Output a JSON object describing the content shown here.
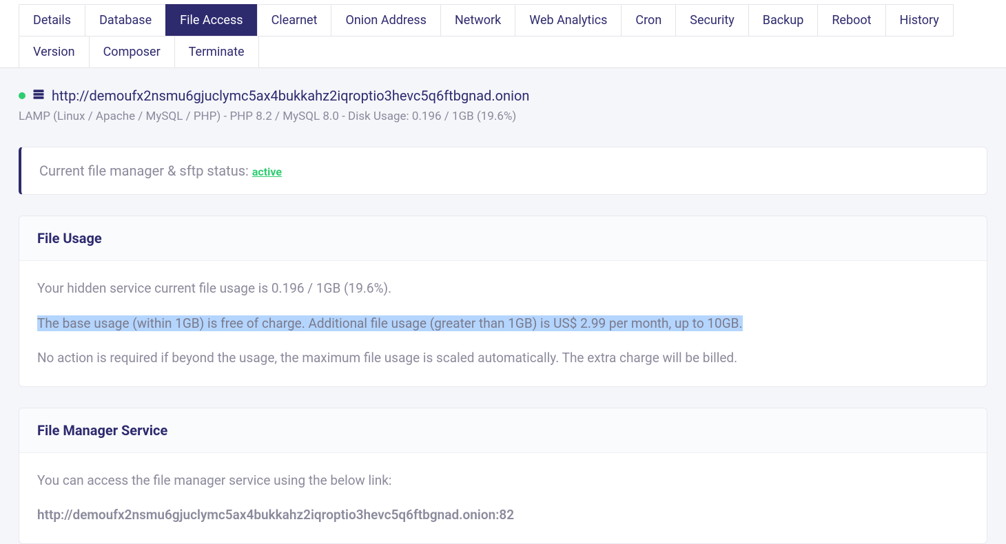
{
  "tabs": {
    "row1": [
      {
        "label": "Details",
        "active": false
      },
      {
        "label": "Database",
        "active": false
      },
      {
        "label": "File Access",
        "active": true
      },
      {
        "label": "Clearnet",
        "active": false
      },
      {
        "label": "Onion Address",
        "active": false
      },
      {
        "label": "Network",
        "active": false
      },
      {
        "label": "Web Analytics",
        "active": false
      },
      {
        "label": "Cron",
        "active": false
      },
      {
        "label": "Security",
        "active": false
      },
      {
        "label": "Backup",
        "active": false
      },
      {
        "label": "Reboot",
        "active": false
      }
    ],
    "row2": [
      {
        "label": "History",
        "active": false
      },
      {
        "label": "Version",
        "active": false
      },
      {
        "label": "Composer",
        "active": false
      },
      {
        "label": "Terminate",
        "active": false
      }
    ]
  },
  "site": {
    "url": "http://demoufx2nsmu6gjuclymc5ax4bukkahz2iqroptio3hevc5q6ftbgnad.onion",
    "meta": "LAMP (Linux / Apache / MySQL / PHP) - PHP 8.2 / MySQL 8.0 - Disk Usage: 0.196 / 1GB (19.6%)"
  },
  "status": {
    "label": "Current file manager & sftp status: ",
    "value": "active"
  },
  "file_usage": {
    "title": "File Usage",
    "p1": "Your hidden service current file usage is 0.196 / 1GB (19.6%).",
    "p2": "The base usage (within 1GB) is free of charge. Additional file usage (greater than 1GB) is US$ 2.99 per month, up to 10GB.",
    "p3": "No action is required if beyond the usage, the maximum file usage is scaled automatically. The extra charge will be billed."
  },
  "file_manager": {
    "title": "File Manager Service",
    "intro": "You can access the file manager service using the below link:",
    "link": "http://demoufx2nsmu6gjuclymc5ax4bukkahz2iqroptio3hevc5q6ftbgnad.onion:82"
  }
}
